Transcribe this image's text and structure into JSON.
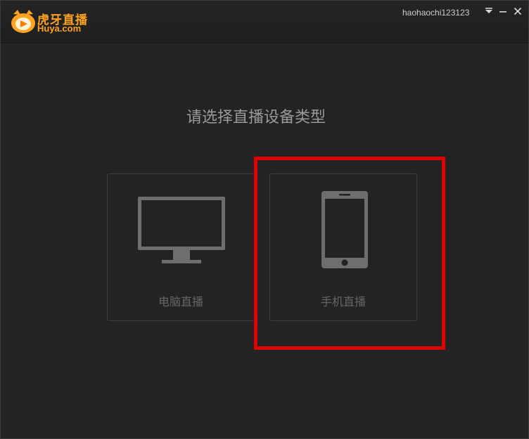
{
  "app": {
    "logo_cn": "虎牙直播",
    "logo_en": "Huya.com",
    "username": "haohaochi123123",
    "accent_color": "#ffa21f"
  },
  "titlebar": {
    "icons": [
      "menu-dropdown-icon",
      "minimize-icon",
      "close-icon"
    ]
  },
  "main": {
    "heading": "请选择直播设备类型",
    "options": [
      {
        "label": "电脑直播",
        "icon": "monitor-icon"
      },
      {
        "label": "手机直播",
        "icon": "smartphone-icon"
      }
    ]
  },
  "annotation": {
    "highlight_color": "#e00000",
    "target": "手机直播"
  }
}
